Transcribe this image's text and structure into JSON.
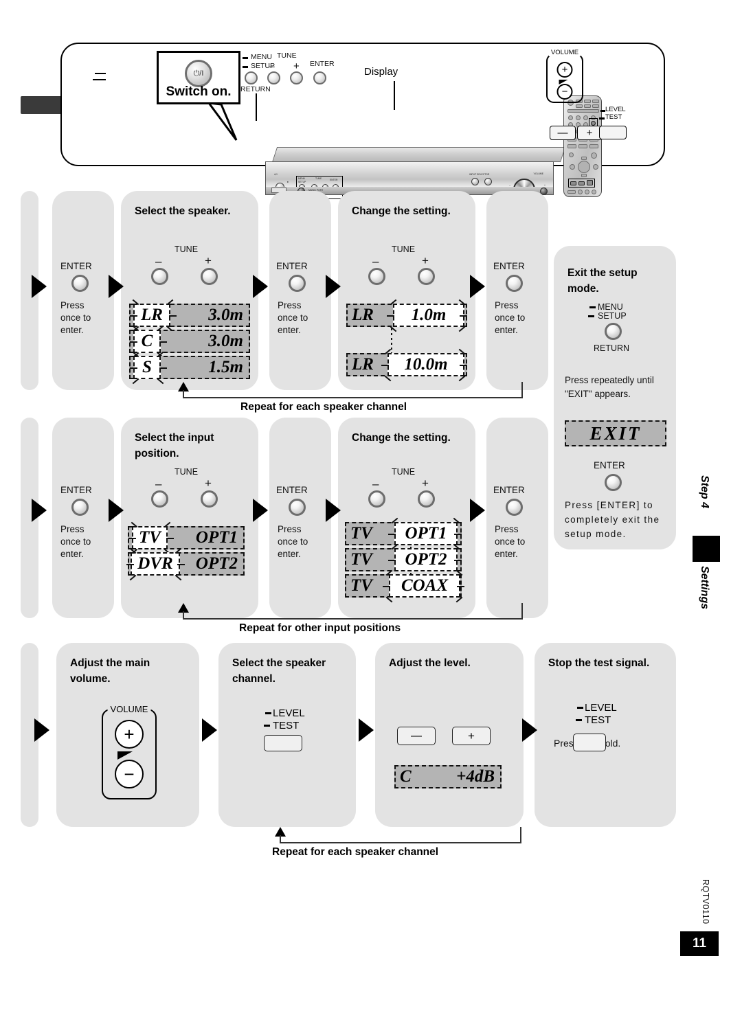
{
  "hardware": {
    "switch_on_label": "Switch on.",
    "power_icon_glyph": "⏻/I",
    "display_label": "Display",
    "front_buttons": {
      "menu_label": "MENU",
      "setup_label": "SETUP",
      "return_label": "RETURN",
      "tune_label": "TUNE",
      "minus_sign": "–",
      "plus_sign": "+",
      "enter_label": "ENTER"
    },
    "remote_callouts": {
      "volume_label": "VOLUME",
      "volume_plus": "+",
      "volume_minus": "−",
      "level_label": "LEVEL",
      "test_label": "TEST",
      "minus_btn": "—",
      "plus_btn": "+"
    }
  },
  "common": {
    "enter_label": "ENTER",
    "press_once_to_enter": "Press\nonce to\nenter.",
    "press_once_line1": "Press",
    "press_once_line2": "once to",
    "press_once_line3": "enter.",
    "tune_label": "TUNE",
    "minus_sign": "–",
    "plus_sign": "+"
  },
  "row1": {
    "panel_speaker_title": "Select the speaker.",
    "panel_change_title": "Change the setting.",
    "speaker_display": [
      {
        "channel": "LR",
        "value": "3.0m",
        "blinking": "channel"
      },
      {
        "channel": "C",
        "value": "3.0m",
        "blinking": "channel"
      },
      {
        "channel": "S",
        "value": "1.5m",
        "blinking": "channel"
      }
    ],
    "change_display": [
      {
        "channel": "LR",
        "value": "1.0m",
        "blinking": "value"
      },
      {
        "channel": "LR",
        "value": "10.0m",
        "blinking": "value"
      }
    ],
    "repeat_text": "Repeat for each speaker channel"
  },
  "row2": {
    "panel_input_title": "Select the input\nposition.",
    "panel_input_title_l1": "Select the input",
    "panel_input_title_l2": "position.",
    "panel_change_title": "Change the setting.",
    "input_display": [
      {
        "channel": "TV",
        "value": "OPT1",
        "blinking": "channel"
      },
      {
        "channel": "DVR",
        "value": "OPT2",
        "blinking": "channel"
      }
    ],
    "change_display": [
      {
        "channel": "TV",
        "value": "OPT1",
        "blinking": "value"
      },
      {
        "channel": "TV",
        "value": "OPT2",
        "blinking": "value"
      },
      {
        "channel": "TV",
        "value": "COAX",
        "blinking": "value"
      }
    ],
    "repeat_text": "Repeat for other input positions"
  },
  "row3": {
    "panel_volume_title_l1": "Adjust the main",
    "panel_volume_title_l2": "volume.",
    "panel_channel_title_l1": "Select the speaker",
    "panel_channel_title_l2": "channel.",
    "panel_level_title": "Adjust the level.",
    "panel_stop_title": "Stop the test signal.",
    "volume_label": "VOLUME",
    "volume_plus": "+",
    "volume_minus": "−",
    "level_label": "LEVEL",
    "test_label": "TEST",
    "minus_btn": "—",
    "plus_btn": "+",
    "level_display": {
      "channel": "C",
      "value": "+4dB"
    },
    "press_and_hold": "Press and hold.",
    "repeat_text": "Repeat for each speaker channel"
  },
  "exit_panel": {
    "title_l1": "Exit the setup",
    "title_l2": "mode.",
    "menu_label": "MENU",
    "setup_label": "SETUP",
    "return_label": "RETURN",
    "instruction_l1": "Press repeatedly until",
    "instruction_l2": "\"EXIT\" appears.",
    "exit_display": "EXIT",
    "enter_label": "ENTER",
    "final_l1": "Press [ENTER] to",
    "final_l2": "completely exit the",
    "final_l3": "setup mode."
  },
  "sidebar": {
    "step_label": "Step 4",
    "section_label": "Settings"
  },
  "footer": {
    "doc_code": "RQTV0110",
    "page_number": "11"
  },
  "colors": {
    "panel_bg": "#e3e3e3",
    "lcd_bg": "#b4b4b4",
    "blink_bg": "#ffffff",
    "accent_black": "#000000"
  }
}
